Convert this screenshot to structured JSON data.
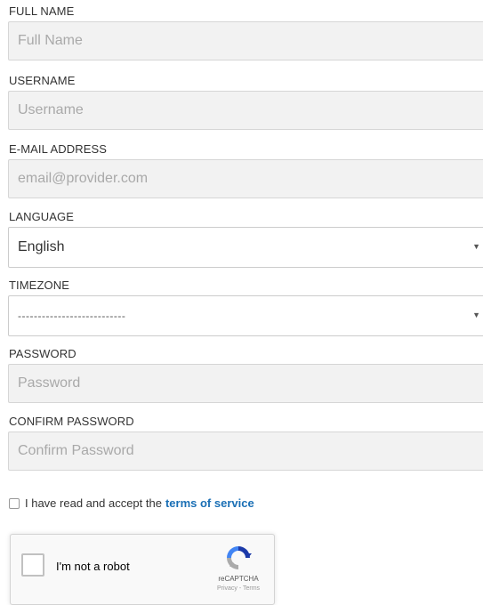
{
  "form": {
    "full_name": {
      "label": "FULL NAME",
      "placeholder": "Full Name"
    },
    "username": {
      "label": "USERNAME",
      "placeholder": "Username"
    },
    "email": {
      "label": "E-MAIL ADDRESS",
      "placeholder": "email@provider.com"
    },
    "language": {
      "label": "LANGUAGE",
      "selected": "English"
    },
    "timezone": {
      "label": "TIMEZONE",
      "selected": "---------------------------"
    },
    "password": {
      "label": "PASSWORD",
      "placeholder": "Password"
    },
    "confirm_password": {
      "label": "CONFIRM PASSWORD",
      "placeholder": "Confirm Password"
    }
  },
  "terms": {
    "text": "I have read and accept the",
    "link_text": "terms of service",
    "checked": false
  },
  "recaptcha": {
    "label": "I'm not a robot",
    "brand": "reCAPTCHA",
    "links": "Privacy - Terms",
    "icon": "recaptcha-logo-icon"
  },
  "colors": {
    "link": "#1a6fb5",
    "input_bg": "#f2f2f2",
    "input_border": "#d6d6d6"
  },
  "icons": {
    "select_arrow": "chevron-down-icon"
  }
}
